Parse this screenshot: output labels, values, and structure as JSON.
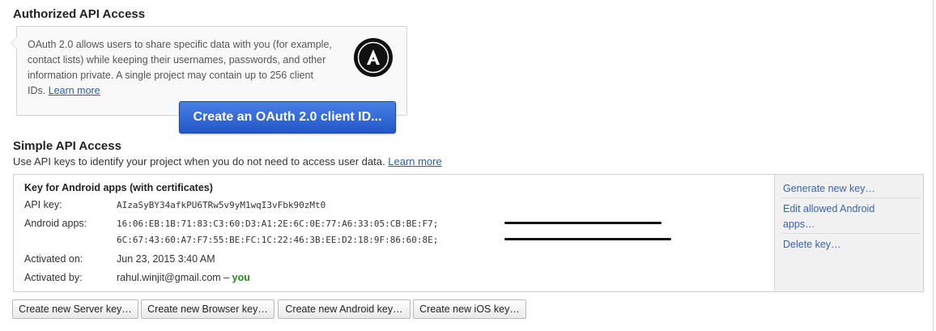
{
  "authorized": {
    "title": "Authorized API Access",
    "description_line1": "OAuth 2.0 allows users to share specific data with you (for example,",
    "description_line2": "contact lists) while keeping their usernames, passwords, and other",
    "description_line3": "information private. A single project may contain up to 256 client",
    "description_line4": "IDs.",
    "learn_more": "Learn more",
    "logo_icon": "oauth-logo-icon",
    "create_button": "Create an OAuth 2.0 client ID..."
  },
  "simple": {
    "title": "Simple API Access",
    "description": "Use API keys to identify your project when you do not need to access user data.",
    "learn_more": "Learn more"
  },
  "key": {
    "title": "Key for Android apps (with certificates)",
    "api_key_label": "API key:",
    "api_key_value": "AIzaSyBY34afkPU6TRw5v9yM1wqI3vFbk90zMt0",
    "android_label": "Android apps:",
    "android_line1": "16:06:EB:1B:71:83:C3:60:D3:A1:2E:6C:0E:77:A6:33:05:CB:BE:F7;",
    "android_line2": "6C:67:43:60:A7:F7:55:BE:FC:1C:22:46:3B:EE:D2:18:9F:86:60:8E;",
    "activated_on_label": "Activated on:",
    "activated_on_value": "Jun 23, 2015 3:40 AM",
    "activated_by_label": "Activated by:",
    "activated_by_value": "rahul.winjit@gmail.com",
    "activated_by_dash": "–",
    "activated_by_you": "you"
  },
  "side_actions": {
    "generate": "Generate new key…",
    "edit_line1": "Edit allowed Android",
    "edit_line2": "apps…",
    "delete": "Delete key…"
  },
  "buttons": {
    "server": "Create new Server key…",
    "browser": "Create new Browser key…",
    "android": "Create new Android key…",
    "ios": "Create new iOS key…"
  },
  "colors": {
    "primary_button": "#2a5ed0",
    "link": "#2a5db0",
    "you": "#2a8a1f"
  }
}
